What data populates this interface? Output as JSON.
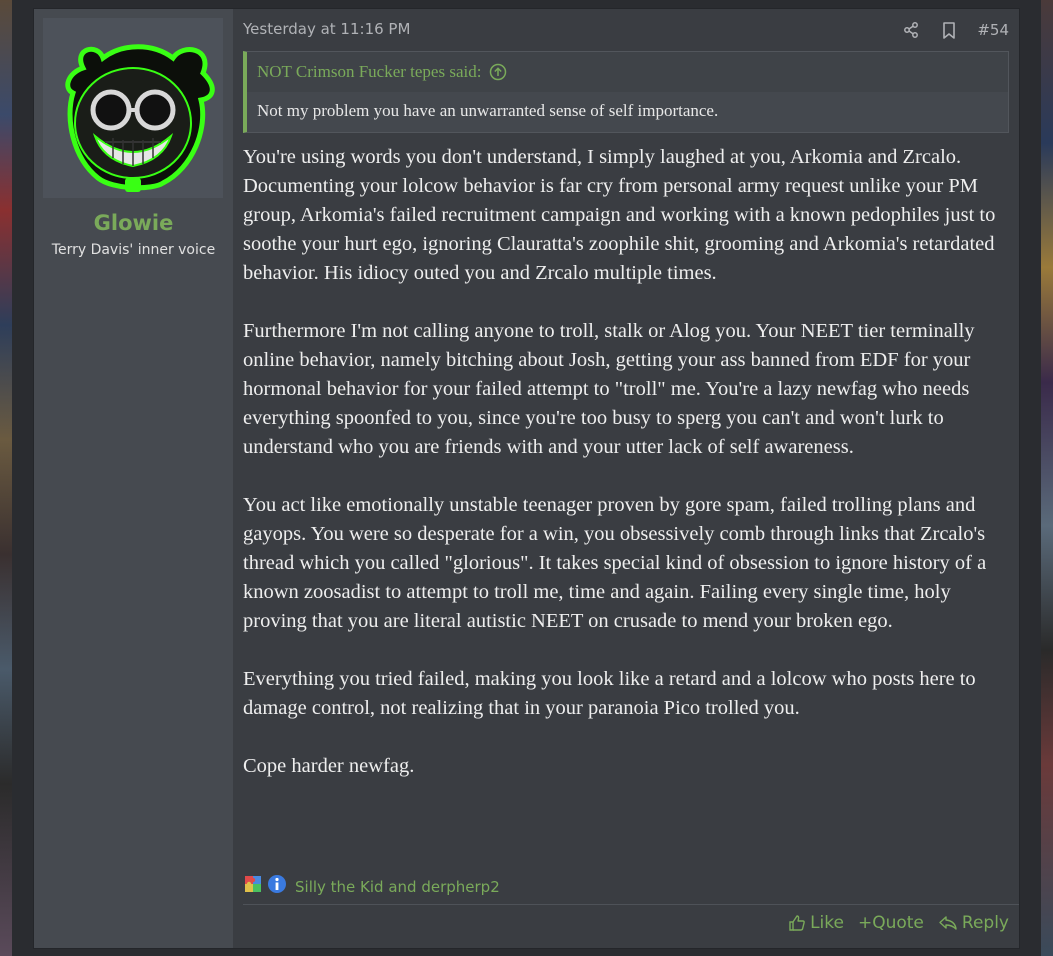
{
  "post": {
    "date": "Yesterday at 11:16 PM",
    "number": "#54",
    "author": {
      "name": "Glowie",
      "title": "Terry Davis' inner voice"
    },
    "quote": {
      "attribution": "NOT Crimson Fucker tepes said:",
      "text": "Not my problem you have an unwarranted sense of self importance."
    },
    "paragraphs": [
      "You're using words you don't understand, I simply laughed at you, Arkomia and Zrcalo. Documenting your lolcow behavior is far cry from personal army request unlike your PM group, Arkomia's failed recruitment campaign and working with a known pedophiles just to soothe your hurt ego, ignoring Clauratta's zoophile shit, grooming and Arkomia's retardated behavior. His idiocy outed you and Zrcalo multiple times.",
      "Furthermore I'm not calling anyone to troll, stalk or Alog you. Your NEET tier terminally online behavior, namely bitching about Josh, getting your ass banned from EDF for your hormonal behavior for your failed attempt to \"troll\" me. You're a lazy newfag who needs everything spoonfed to you, since you're too busy to sperg you can't and won't lurk to understand who you are friends with and your utter lack of self awareness.",
      "You act like emotionally unstable teenager proven by gore spam, failed trolling plans and gayops. You were so desperate for a win, you obsessively comb through links that Zrcalo's thread which you called \"glorious\". It takes special kind of obsession to ignore history of a known zoosadist to attempt to troll me, time and again. Failing every single time, holy proving that you are literal autistic NEET on crusade to mend your broken ego.",
      "Everything you tried failed, making you look like a retard and a lolcow who posts here to damage control, not realizing that in your paranoia Pico trolled you.",
      "Cope harder newfag."
    ],
    "reactions": {
      "icons": [
        "autistic-puzzle-icon",
        "informative-icon"
      ],
      "names": "Silly the Kid and derpherp2"
    },
    "actions": {
      "like": "Like",
      "quote": "+Quote",
      "reply": "Reply"
    },
    "colors": {
      "accent": "#7aaa5a",
      "background": "#3a3d42",
      "sidebar": "#464a50"
    }
  }
}
